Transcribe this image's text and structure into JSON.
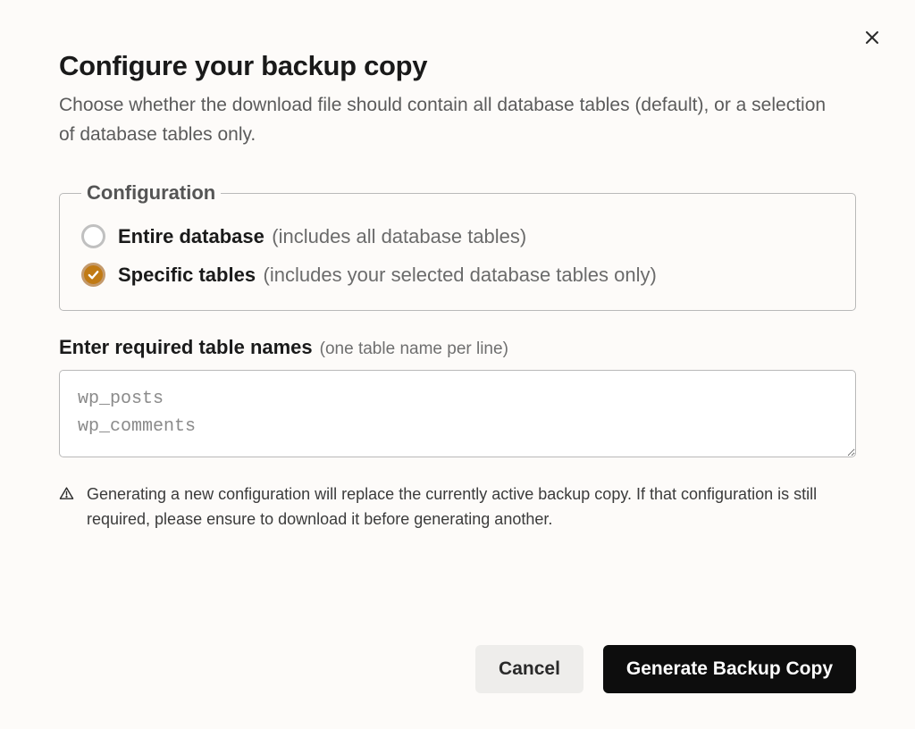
{
  "header": {
    "title": "Configure your backup copy",
    "subtitle": "Choose whether the download file should contain all database tables (default), or a selection of database tables only."
  },
  "config": {
    "legend": "Configuration",
    "options": [
      {
        "label": "Entire database",
        "hint": "(includes all database tables)",
        "selected": false
      },
      {
        "label": "Specific tables",
        "hint": "(includes your selected database tables only)",
        "selected": true
      }
    ]
  },
  "tables": {
    "label": "Enter required table names",
    "hint": "(one table name per line)",
    "placeholder": "wp_posts\nwp_comments",
    "value": ""
  },
  "warning": {
    "text": "Generating a new configuration will replace the currently active backup copy. If that configuration is still required, please ensure to download it before generating another."
  },
  "footer": {
    "cancel": "Cancel",
    "primary": "Generate Backup Copy"
  }
}
